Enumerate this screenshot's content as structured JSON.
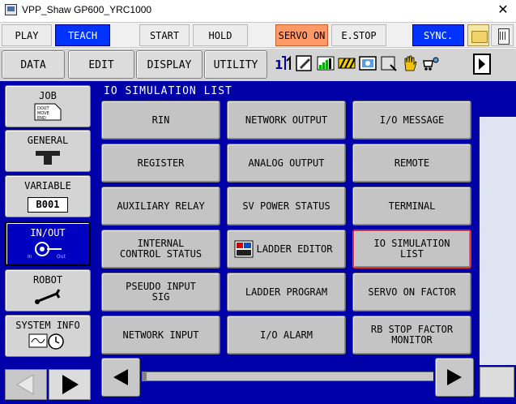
{
  "window": {
    "title": "VPP_Shaw GP600_YRC1000",
    "close_glyph": "✕"
  },
  "toolbar": {
    "play": "PLAY",
    "teach": "TEACH",
    "start": "START",
    "hold": "HOLD",
    "servo_on": "SERVO ON",
    "estop": "E.STOP",
    "sync": "SYNC."
  },
  "menu": {
    "data": "DATA",
    "edit": "EDIT",
    "display": "DISPLAY",
    "utility": "UTILITY"
  },
  "status_icons": [
    "axis-12-icon",
    "edit-pencil-icon",
    "level-bars-icon",
    "hazard-stripes-icon",
    "teach-screen-icon",
    "program-icon",
    "hand-stop-icon",
    "security-cart-icon"
  ],
  "sidebar": {
    "job": "JOB",
    "job_icon_text": "DOUT MOVE END",
    "general": "GENERAL",
    "variable": "VARIABLE",
    "variable_badge": "B001",
    "inout": "IN/OUT",
    "inout_icon_text": "In   Out",
    "robot": "ROBOT",
    "system_info": "SYSTEM INFO"
  },
  "panel": {
    "title": "IO SIMULATION LIST",
    "items": [
      [
        "RIN",
        "NETWORK OUTPUT",
        "I/O MESSAGE"
      ],
      [
        "REGISTER",
        "ANALOG OUTPUT",
        "REMOTE"
      ],
      [
        "AUXILIARY RELAY",
        "SV POWER STATUS",
        "TERMINAL"
      ],
      [
        "INTERNAL\n CONTROL STATUS",
        "LADDER EDITOR",
        "IO SIMULATION\n LIST"
      ],
      [
        "PSEUDO INPUT\nSIG",
        "LADDER PROGRAM",
        "SERVO ON FACTOR"
      ],
      [
        "NETWORK INPUT",
        "I/O ALARM",
        "RB STOP FACTOR\nMONITOR"
      ]
    ],
    "selected": "IO SIMULATION LIST",
    "ladder_icon_text": "LADD ER"
  },
  "colors": {
    "panel_blue": "#0000a8",
    "teach_blue": "#0033ff",
    "servo_orange": "#ff9966",
    "selected_border": "#e03030"
  }
}
